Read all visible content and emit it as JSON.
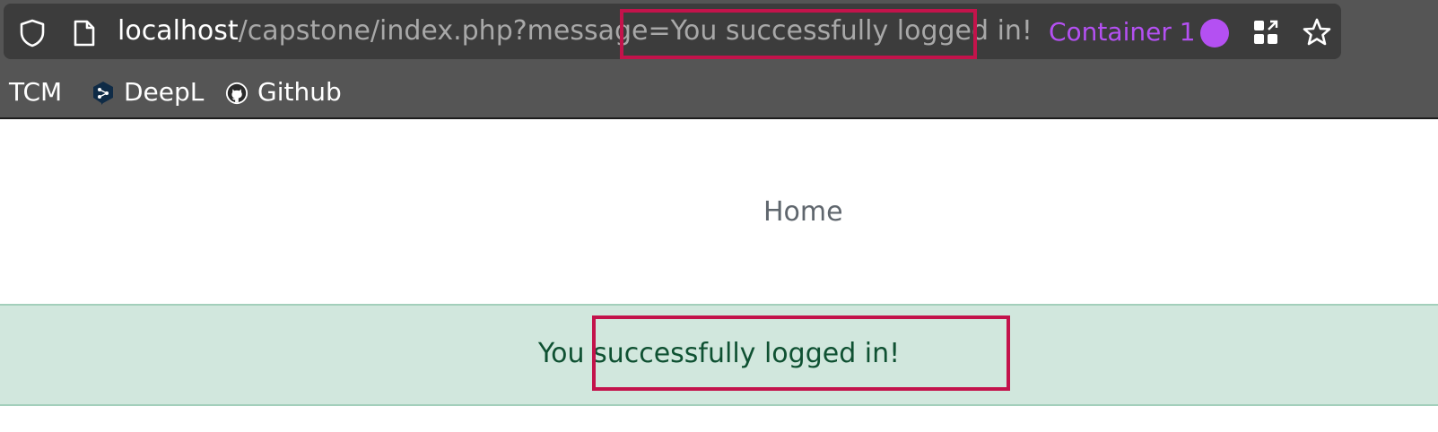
{
  "browser": {
    "url_host": "localhost",
    "url_path": "/capstone/index.php?message=",
    "url_param": "You successfully logged in!",
    "container_label": "Container 1",
    "container_color": "#b450f2",
    "icons": [
      "shield-icon",
      "page-icon",
      "extensions-grid-icon",
      "bookmark-star-icon"
    ]
  },
  "bookmarks": [
    {
      "label": "TCM",
      "icon": ""
    },
    {
      "label": "DeepL",
      "icon": "deepl-icon"
    },
    {
      "label": "Github",
      "icon": "github-icon"
    }
  ],
  "nav": {
    "home_label": "Home"
  },
  "alert": {
    "message": "You successfully logged in!",
    "background": "#d1e7dd",
    "text_color": "#0f5132"
  },
  "highlight_color": "#c3134b"
}
